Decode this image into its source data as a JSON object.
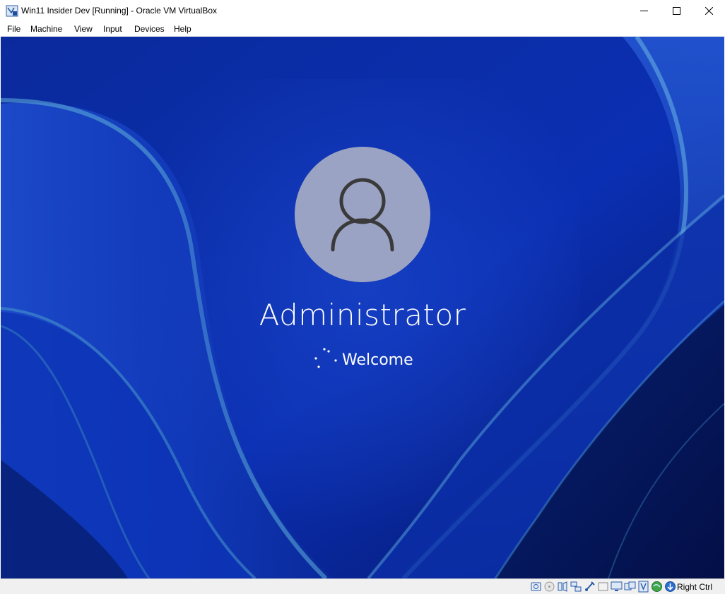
{
  "window": {
    "title": "Win11 Insider Dev [Running] - Oracle VM VirtualBox",
    "icon": "virtualbox-icon"
  },
  "menu": {
    "items": [
      {
        "label": "File"
      },
      {
        "label": "Machine"
      },
      {
        "label": "View"
      },
      {
        "label": "Input"
      },
      {
        "label": "Devices"
      },
      {
        "label": "Help"
      }
    ]
  },
  "login_screen": {
    "username": "Administrator",
    "status": "Welcome",
    "avatar_icon": "user-silhouette-icon",
    "spinner_icon": "loading-spinner-icon"
  },
  "status_bar": {
    "icons": [
      "hard-disk-icon",
      "optical-drive-icon",
      "audio-icon",
      "network-icon",
      "usb-icon",
      "shared-folders-icon",
      "display-icon",
      "recording-icon",
      "vt-x-icon",
      "guest-additions-icon",
      "mouse-integration-icon"
    ],
    "host_key": "Right Ctrl"
  },
  "colors": {
    "wallpaper_deep": "#061a6e",
    "wallpaper_mid": "#0a2fb0",
    "wallpaper_light": "#3a6fe0",
    "avatar_bg": "#9aa3c3",
    "avatar_stroke": "#3a3a3a",
    "text": "#ffffff"
  }
}
